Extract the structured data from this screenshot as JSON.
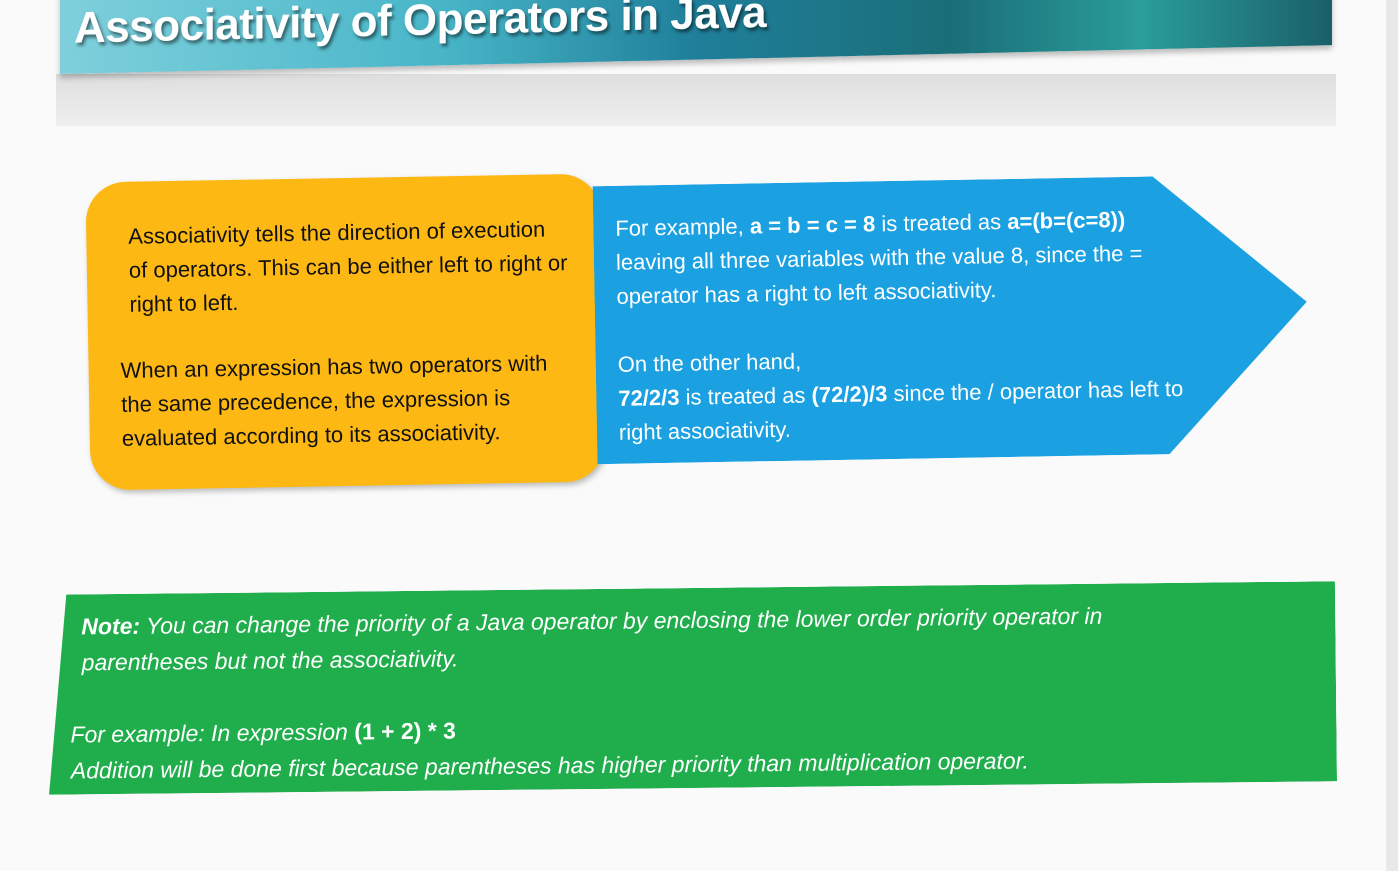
{
  "title": "Associativity of Operators in Java",
  "colors": {
    "orange_box": "#fdb813",
    "blue_arrow": "#1ba1e2",
    "green_note": "#1fae4b",
    "banner": "#2a9daf"
  },
  "orange_box": {
    "paragraph1": "Associativity tells the direction of execution of operators. This can be either left to right or right to left.",
    "paragraph2": "When an expression has two operators with the same precedence, the expression is evaluated according to its associativity."
  },
  "blue_arrow": {
    "p1_lead": "For example, ",
    "p1_expr": "a = b = c = 8",
    "p1_mid": " is treated as ",
    "p1_expr2": "a=(b=(c=8))",
    "p1_rest": " leaving all three variables with the value 8, since the = operator has a right to left associativity.",
    "p2_line1": "On the other hand,",
    "p2_expr": "72/2/3",
    "p2_mid": " is treated as ",
    "p2_expr2": "(72/2)/3",
    "p2_rest": " since the / operator has left to right associativity."
  },
  "note": {
    "label": "Note:",
    "text": " You can change the priority of a Java operator by enclosing the lower order priority operator in parentheses but not the associativity.",
    "example_lead": "For example: In expression ",
    "example_expr": "(1 + 2) * 3",
    "example_text": "Addition will be done first because parentheses has higher priority than multiplication operator."
  }
}
